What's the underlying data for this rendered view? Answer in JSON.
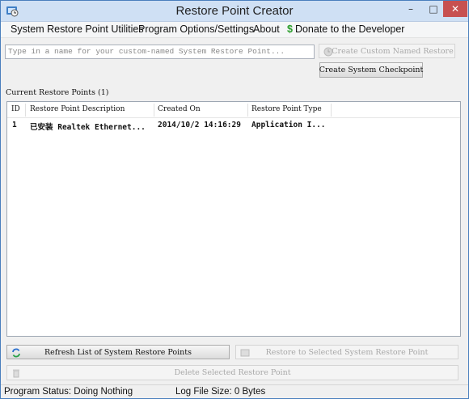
{
  "window": {
    "title": "Restore Point Creator"
  },
  "menu": {
    "items": [
      "System Restore Point Utilities",
      "Program Options/Settings",
      "About",
      "Donate to the Developer"
    ]
  },
  "create": {
    "input_placeholder": "Type in a name for your custom-named System Restore Point...",
    "custom_button": "Create Custom Named Restore",
    "checkpoint_button": "Create System Checkpoint"
  },
  "list": {
    "label": "Current Restore Points (1)",
    "columns": [
      "ID",
      "Restore Point Description",
      "Created On",
      "Restore Point Type"
    ],
    "rows": [
      {
        "id": "1",
        "description": "已安装 Realtek Ethernet...",
        "created": "2014/10/2 14:16:29",
        "type": "Application I..."
      }
    ]
  },
  "actions": {
    "refresh": "Refresh List of System Restore Points",
    "restore": "Restore to Selected System Restore Point",
    "delete": "Delete Selected Restore Point"
  },
  "status": {
    "program_status": "Program Status:  Doing Nothing",
    "log_file_size": "Log File Size:  0 Bytes"
  },
  "colors": {
    "titlebar": "#cfe0f4",
    "close": "#c75050",
    "donate": "#2a9d2a"
  }
}
